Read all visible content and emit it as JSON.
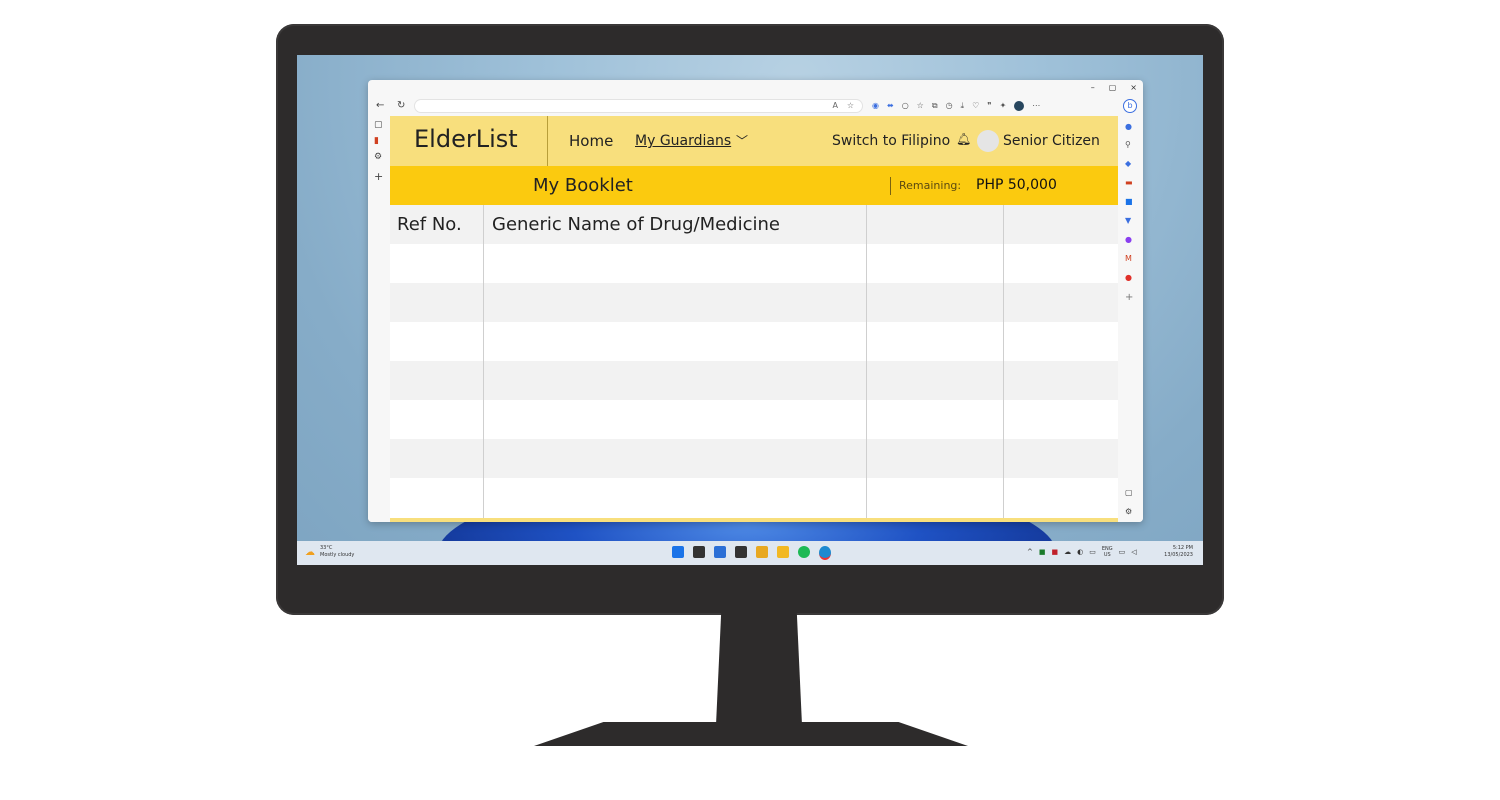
{
  "browser": {
    "window_controls": [
      "–",
      "▢",
      "×"
    ]
  },
  "app": {
    "logo": "ElderList",
    "nav": {
      "home": "Home",
      "guardians": "My Guardians",
      "language": "Switch to Filipino",
      "user": "Senior Citizen"
    },
    "booklet": {
      "title": "My Booklet",
      "remaining_label": "Remaining:",
      "remaining_value": "PHP 50,000"
    },
    "table": {
      "headers": [
        "Ref No.",
        "Generic Name of Drug/Medicine",
        "",
        ""
      ]
    }
  },
  "taskbar": {
    "temperature": "33°C",
    "weather": "Mostly cloudy",
    "lang": "ENG",
    "region": "US",
    "time": "5:12 PM",
    "date": "13/05/2023"
  },
  "colors": {
    "nav_bg": "#f8df7d",
    "band_bg": "#fbca0f",
    "row_gray": "#f2f2f2"
  }
}
